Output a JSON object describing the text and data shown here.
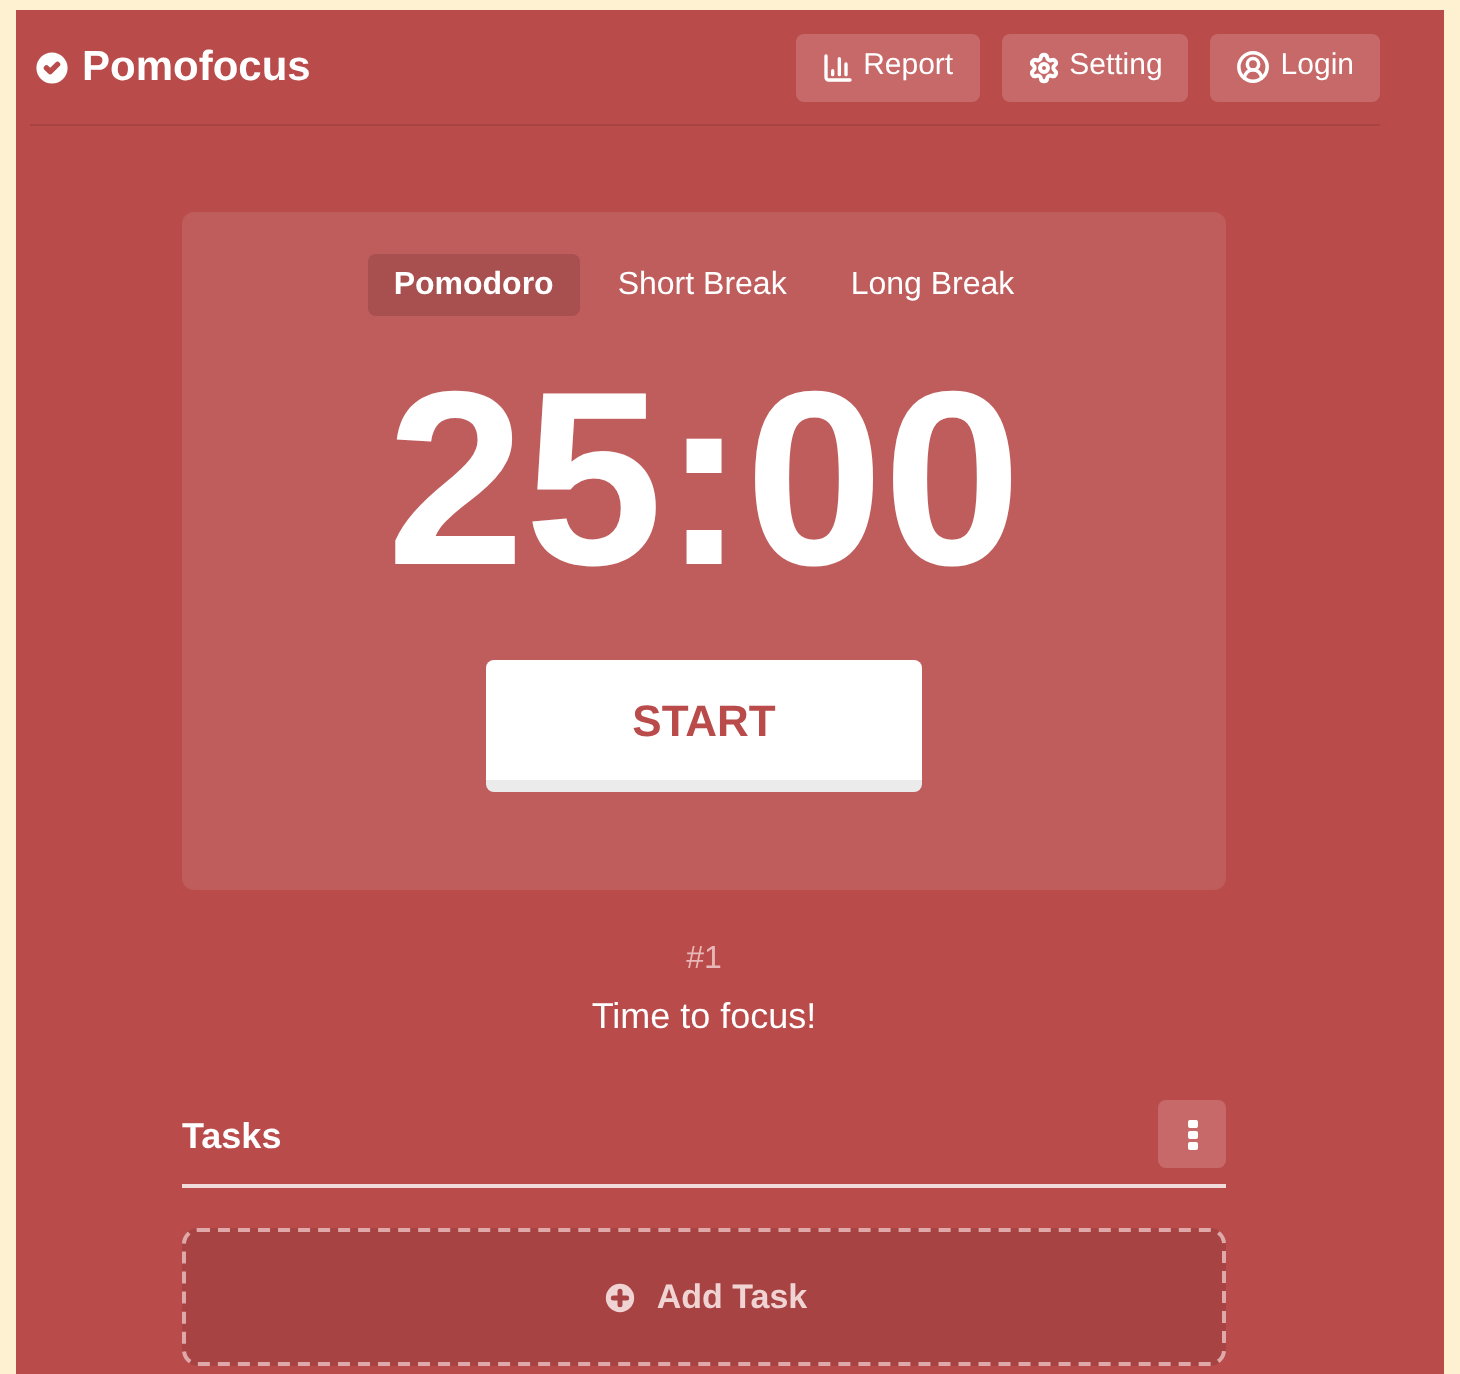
{
  "header": {
    "logo": "Pomofocus",
    "buttons": [
      {
        "kind": "report",
        "label": "Report"
      },
      {
        "kind": "setting",
        "label": "Setting"
      },
      {
        "kind": "login",
        "label": "Login"
      }
    ]
  },
  "timer": {
    "modes": [
      {
        "label": "Pomodoro",
        "selected": true
      },
      {
        "label": "Short Break",
        "selected": false
      },
      {
        "label": "Long Break",
        "selected": false
      }
    ],
    "time": "25:00",
    "start_button": "START"
  },
  "session": {
    "count": "#1",
    "message": "Time to focus!"
  },
  "tasks": {
    "title": "Tasks",
    "add_button": "Add Task"
  }
}
